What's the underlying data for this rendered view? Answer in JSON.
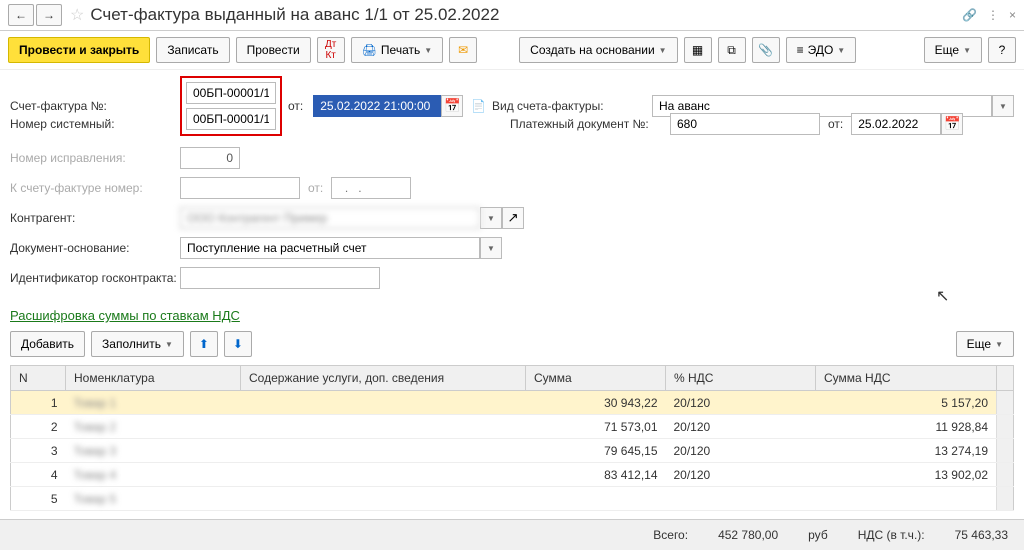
{
  "header": {
    "title": "Счет-фактура выданный на аванс 1/1 от 25.02.2022"
  },
  "toolbar": {
    "post_close": "Провести и закрыть",
    "save": "Записать",
    "post": "Провести",
    "print": "Печать",
    "create_based": "Создать на основании",
    "edo": "ЭДО",
    "more": "Еще"
  },
  "form": {
    "invoice_no_label": "Счет-фактура №:",
    "invoice_no": "00БП-00001/1",
    "sys_no_label": "Номер системный:",
    "sys_no": "00БП-00001/1",
    "from_label": "от:",
    "datetime": "25.02.2022 21:00:00",
    "corr_no_label": "Номер исправления:",
    "corr_no": "0",
    "to_invoice_label": "К счету-фактуре номер:",
    "dot_placeholder": "  .   .",
    "counterparty_label": "Контрагент:",
    "basis_label": "Документ-основание:",
    "basis_value": "Поступление на расчетный счет",
    "contract_id_label": "Идентификатор госконтракта:",
    "invoice_type_label": "Вид счета-фактуры:",
    "invoice_type": "На аванс",
    "payment_doc_label": "Платежный документ №:",
    "payment_doc_no": "680",
    "payment_doc_date": "25.02.2022"
  },
  "section": {
    "vat_breakdown": "Расшифровка суммы по ставкам НДС",
    "add": "Добавить",
    "fill": "Заполнить",
    "more": "Еще"
  },
  "table": {
    "headers": {
      "n": "N",
      "nomenclature": "Номенклатура",
      "content": "Содержание услуги, доп. сведения",
      "sum": "Сумма",
      "vat_rate": "% НДС",
      "vat_sum": "Сумма НДС"
    },
    "rows": [
      {
        "n": "1",
        "nom": "Товар 1",
        "sum": "30 943,22",
        "vat": "20/120",
        "vsum": "5 157,20"
      },
      {
        "n": "2",
        "nom": "Товар 2",
        "sum": "71 573,01",
        "vat": "20/120",
        "vsum": "11 928,84"
      },
      {
        "n": "3",
        "nom": "Товар 3",
        "sum": "79 645,15",
        "vat": "20/120",
        "vsum": "13 274,19"
      },
      {
        "n": "4",
        "nom": "Товар 4",
        "sum": "83 412,14",
        "vat": "20/120",
        "vsum": "13 902,02"
      },
      {
        "n": "5",
        "nom": "Товар 5",
        "sum": "",
        "vat": "",
        "vsum": ""
      }
    ]
  },
  "footer": {
    "total_label": "Всего:",
    "total": "452 780,00",
    "currency": "руб",
    "vat_label": "НДС (в т.ч.):",
    "vat_total": "75 463,33"
  }
}
